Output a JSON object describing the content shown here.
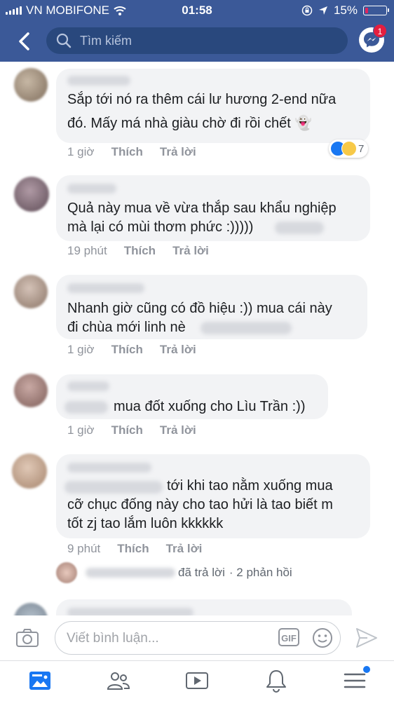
{
  "status_bar": {
    "carrier": "VN MOBIFONE",
    "time": "01:58",
    "battery": "15%",
    "battery_level": 0.15
  },
  "header": {
    "search_placeholder": "Tìm kiếm",
    "messenger_badge": "1"
  },
  "comments": [
    {
      "lines": [
        "Sắp tới nó ra thêm cái lư hương 2-end nữa",
        "đó. Mấy má nhà giàu chờ đi rồi chết 👻"
      ],
      "time": "1 giờ",
      "like": "Thích",
      "reply": "Trả lời",
      "reaction_count": "7"
    },
    {
      "lines": [
        "Quả này mua về vừa thắp sau khẩu nghiệp",
        "mà lại có mùi thơm phức :)))))"
      ],
      "time": "19 phút",
      "like": "Thích",
      "reply": "Trả lời"
    },
    {
      "lines": [
        "Nhanh giờ cũng có đồ hiệu :)) mua cái này",
        "đi chùa mới linh nè"
      ],
      "time": "1 giờ",
      "like": "Thích",
      "reply": "Trả lời"
    },
    {
      "lines": [
        "mua đốt xuống cho Lìu Trần :))"
      ],
      "time": "1 giờ",
      "like": "Thích",
      "reply": "Trả lời"
    },
    {
      "lines": [
        "tới khi tao nằm xuống mua",
        "cỡ chục đống này cho tao hửi là tao biết m",
        "tốt zj tao lắm luôn kkkkkk"
      ],
      "time": "9 phút",
      "like": "Thích",
      "reply": "Trả lời"
    }
  ],
  "replies_summary": {
    "action": "đã trả lời",
    "count": "· 2 phản hồi"
  },
  "composer": {
    "placeholder": "Viết bình luận...",
    "gif_label": "GIF"
  },
  "colors": {
    "brand": "#3b5998",
    "bubble": "#f2f3f5",
    "meta": "#90949c"
  },
  "icons": [
    "back-icon",
    "search-icon",
    "messenger-icon",
    "camera-icon",
    "gif-icon",
    "emoji-icon",
    "send-icon",
    "news-feed-icon",
    "friends-icon",
    "watch-icon",
    "notifications-icon",
    "menu-icon"
  ]
}
